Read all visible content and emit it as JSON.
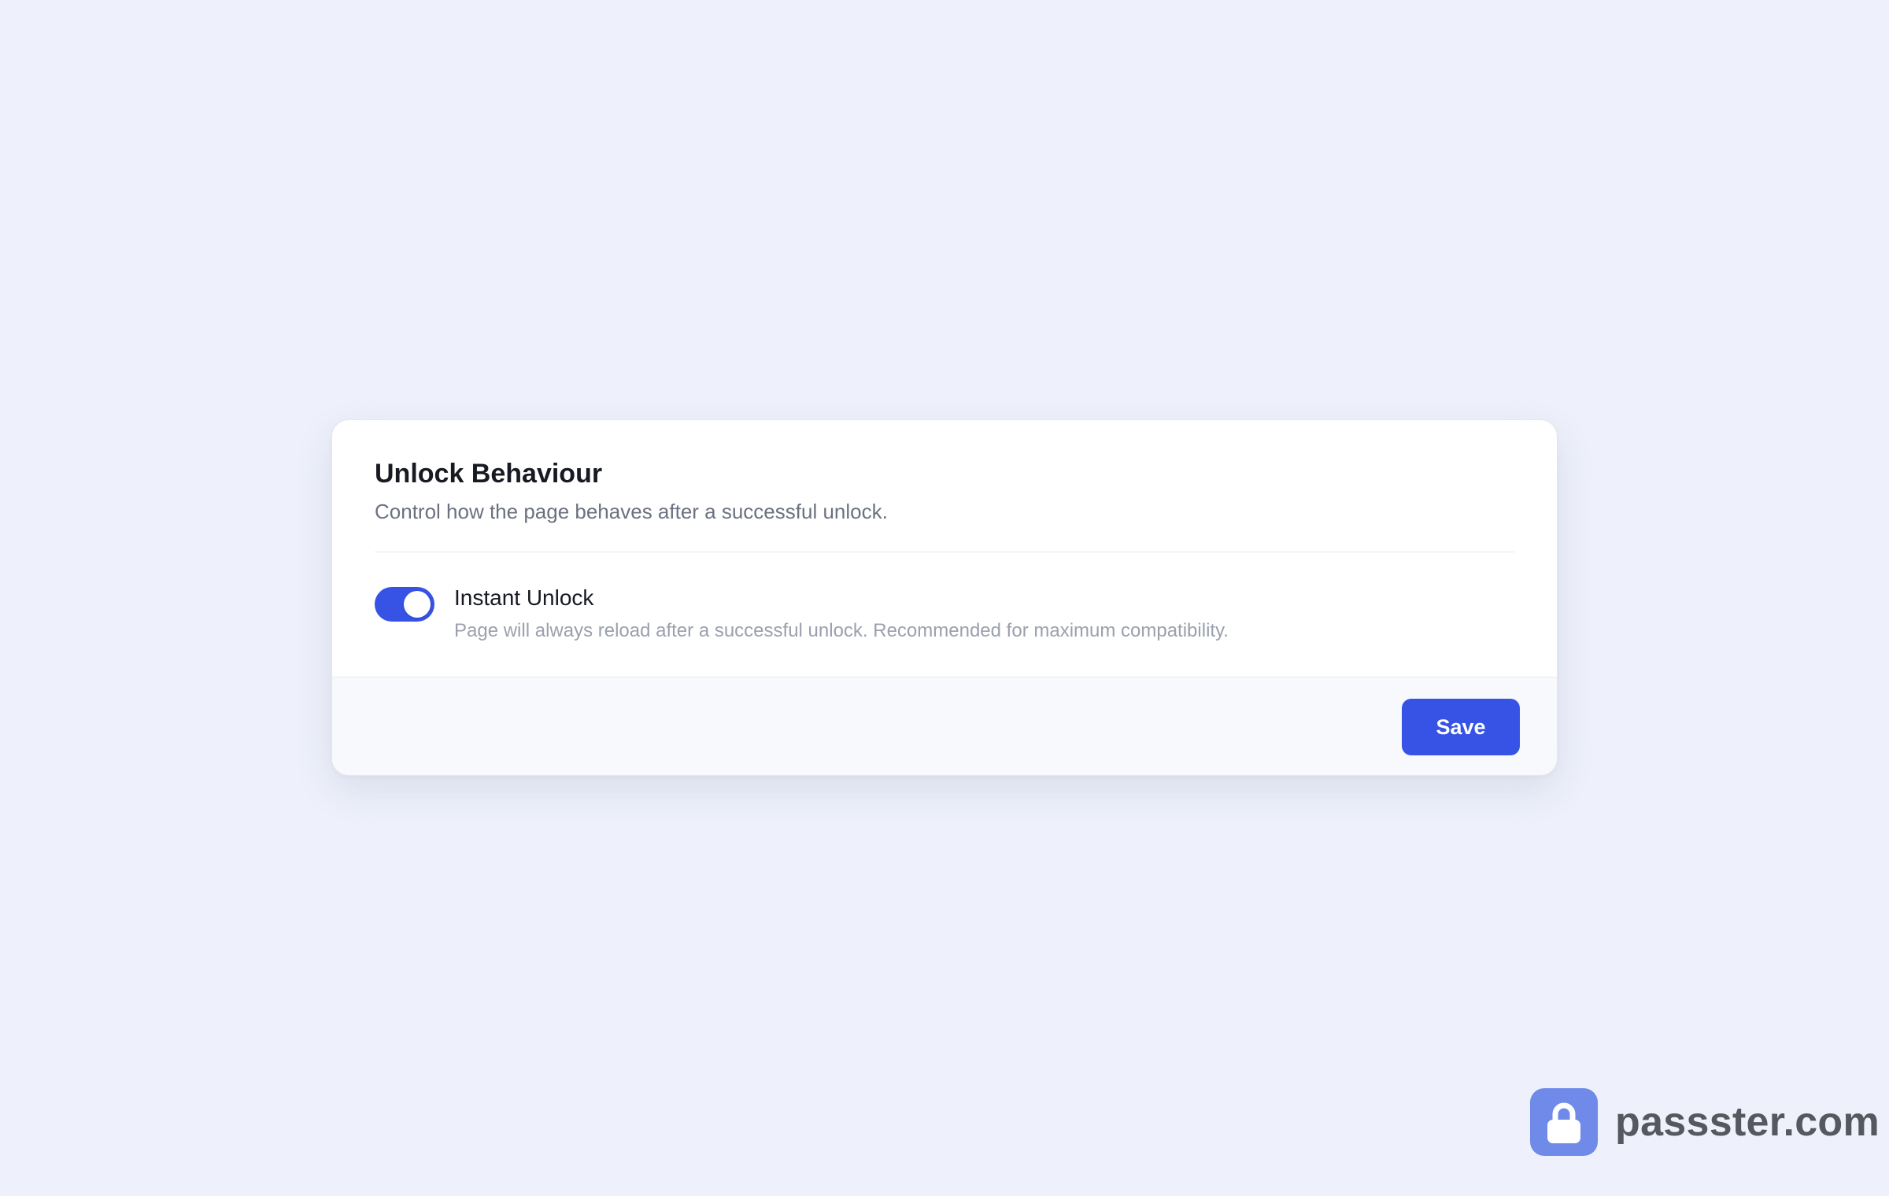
{
  "card": {
    "title": "Unlock Behaviour",
    "subtitle": "Control how the page behaves after a successful unlock."
  },
  "setting": {
    "label": "Instant Unlock",
    "description": "Page will always reload after a successful unlock. Recommended for maximum compatibility.",
    "enabled": true,
    "icon": "toggle-switch"
  },
  "footer": {
    "save_label": "Save"
  },
  "brand": {
    "text": "passster.com",
    "icon": "lock-icon"
  },
  "colors": {
    "accent": "#3653e6",
    "background": "#eef1fb",
    "logo": "#6f8ae8"
  }
}
